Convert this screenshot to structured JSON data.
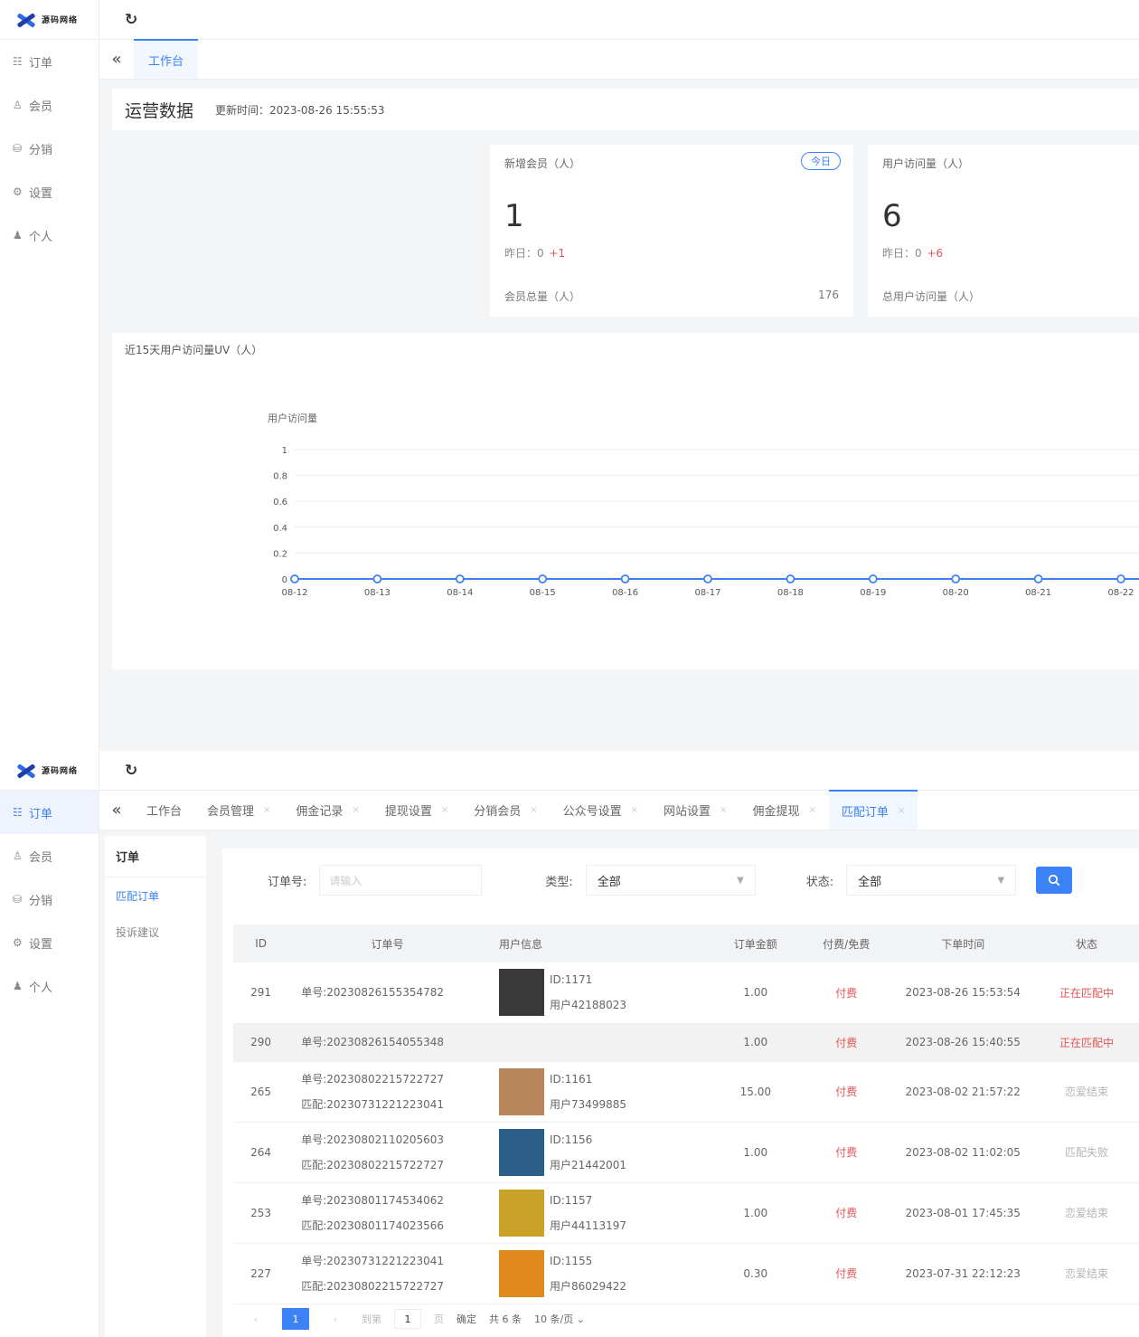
{
  "app": {
    "logo_text": "源码网络"
  },
  "nav": [
    {
      "label": "订单",
      "icon": "list-icon",
      "glyph": "☷"
    },
    {
      "label": "会员",
      "icon": "user-outline-icon",
      "glyph": "♙"
    },
    {
      "label": "分销",
      "icon": "database-icon",
      "glyph": "⛁"
    },
    {
      "label": "设置",
      "icon": "gear-icon",
      "glyph": "⚙"
    },
    {
      "label": "个人",
      "icon": "person-icon",
      "glyph": "♟"
    }
  ],
  "dashboard": {
    "tab_label": "工作台",
    "title": "运营数据",
    "update_time": "更新时间：2023-08-26 15:55:53",
    "cards": [
      {
        "title": "新增会员（人）",
        "badge": "今日",
        "value": "1",
        "yesterday_label": "昨日：",
        "yesterday_value": "0",
        "delta": "+1",
        "total_label": "会员总量（人）",
        "total_value": "176"
      },
      {
        "title": "用户访问量（人）",
        "value": "6",
        "yesterday_label": "昨日：",
        "yesterday_value": "0",
        "delta": "+6",
        "total_label": "总用户访问量（人）",
        "total_value": ""
      }
    ],
    "chart_title": "近15天用户访问量UV（人）"
  },
  "chart_data": {
    "type": "line",
    "title": "近15天用户访问量UV（人）",
    "ylabel": "用户访问量",
    "xlabel": "",
    "categories": [
      "08-12",
      "08-13",
      "08-14",
      "08-15",
      "08-16",
      "08-17",
      "08-18",
      "08-19",
      "08-20",
      "08-21",
      "08-22"
    ],
    "series": [
      {
        "values": [
          0,
          0,
          0,
          0,
          0,
          0,
          0,
          0,
          0,
          0,
          0
        ]
      }
    ],
    "ylim": [
      0,
      1
    ],
    "yticks": [
      "0",
      "0.2",
      "0.4",
      "0.6",
      "0.8",
      "1"
    ],
    "grid": true,
    "color": "#3b82f6"
  },
  "orders_page": {
    "tabs": [
      {
        "label": "工作台",
        "active": false,
        "closable": false
      },
      {
        "label": "会员管理",
        "active": false,
        "closable": true
      },
      {
        "label": "佣金记录",
        "active": false,
        "closable": true
      },
      {
        "label": "提现设置",
        "active": false,
        "closable": true
      },
      {
        "label": "分销会员",
        "active": false,
        "closable": true
      },
      {
        "label": "公众号设置",
        "active": false,
        "closable": true
      },
      {
        "label": "网站设置",
        "active": false,
        "closable": true
      },
      {
        "label": "佣金提现",
        "active": false,
        "closable": true
      },
      {
        "label": "匹配订单",
        "active": true,
        "closable": true
      }
    ],
    "subnav_title": "订单",
    "subnav_items": [
      {
        "label": "匹配订单",
        "active": true
      },
      {
        "label": "投诉建议",
        "active": false
      }
    ],
    "filters": {
      "order_no_label": "订单号:",
      "order_no_placeholder": "请输入",
      "type_label": "类型:",
      "type_value": "全部",
      "status_label": "状态:",
      "status_value": "全部"
    },
    "columns": [
      "ID",
      "订单号",
      "用户信息",
      "订单金额",
      "付费/免费",
      "下单时间",
      "状态"
    ],
    "rows": [
      {
        "id": "291",
        "order": "单号:20230826155354782",
        "match": "",
        "has_user": true,
        "thumb": "#3a3a3a",
        "uid": "ID:1171",
        "uname": "用户42188023",
        "amount": "1.00",
        "pay": "付费",
        "time": "2023-08-26 15:53:54",
        "status": "正在匹配中",
        "status_type": "matching"
      },
      {
        "id": "290",
        "order": "单号:20230826154055348",
        "match": "",
        "has_user": false,
        "thumb": "",
        "uid": "",
        "uname": "",
        "amount": "1.00",
        "pay": "付费",
        "time": "2023-08-26 15:40:55",
        "status": "正在匹配中",
        "status_type": "matching"
      },
      {
        "id": "265",
        "order": "单号:20230802215722727",
        "match": "匹配:20230731221223041",
        "has_user": true,
        "thumb": "#b8865a",
        "uid": "ID:1161",
        "uname": "用户73499885",
        "amount": "15.00",
        "pay": "付费",
        "time": "2023-08-02 21:57:22",
        "status": "恋爱结束",
        "status_type": "ended"
      },
      {
        "id": "264",
        "order": "单号:20230802110205603",
        "match": "匹配:20230802215722727",
        "has_user": true,
        "thumb": "#2c5f8a",
        "uid": "ID:1156",
        "uname": "用户21442001",
        "amount": "1.00",
        "pay": "付费",
        "time": "2023-08-02 11:02:05",
        "status": "匹配失败",
        "status_type": "ended"
      },
      {
        "id": "253",
        "order": "单号:20230801174534062",
        "match": "匹配:20230801174023566",
        "has_user": true,
        "thumb": "#c9a227",
        "uid": "ID:1157",
        "uname": "用户44113197",
        "amount": "1.00",
        "pay": "付费",
        "time": "2023-08-01 17:45:35",
        "status": "恋爱结束",
        "status_type": "ended"
      },
      {
        "id": "227",
        "order": "单号:20230731221223041",
        "match": "匹配:20230802215722727",
        "has_user": true,
        "thumb": "#e08a1e",
        "uid": "ID:1155",
        "uname": "用户86029422",
        "amount": "0.30",
        "pay": "付费",
        "time": "2023-07-31 22:12:23",
        "status": "恋爱结束",
        "status_type": "ended"
      }
    ],
    "pagination": {
      "current": "1",
      "goto_label": "到第",
      "goto_value": "1",
      "page_unit": "页",
      "confirm": "确定",
      "total": "共 6 条",
      "page_size": "10 条/页"
    }
  }
}
